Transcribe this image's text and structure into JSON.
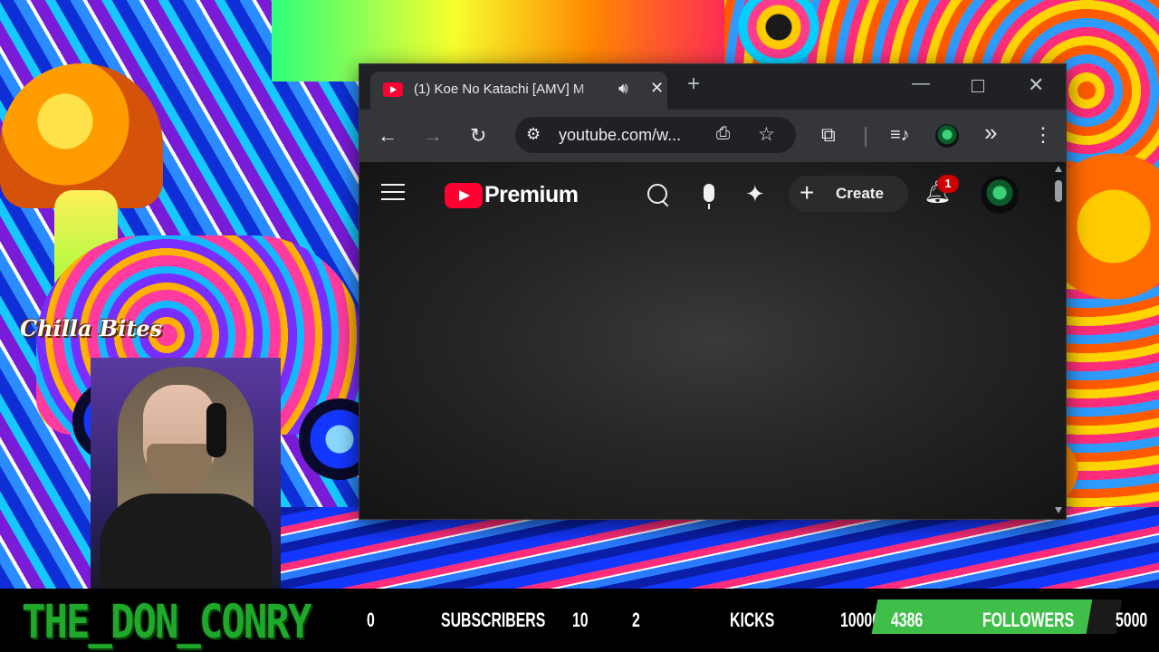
{
  "browser": {
    "tab": {
      "title": "(1) Koe No Katachi [AMV] M",
      "audio_icon": "speaker-icon",
      "close_glyph": "✕"
    },
    "new_tab_glyph": "+",
    "window_controls": {
      "minimize": "—",
      "close": "✕"
    },
    "toolbar": {
      "back": "←",
      "forward": "→",
      "reload": "↻",
      "url": "youtube.com/w...",
      "install_icon": "install-app-icon",
      "bookmark": "☆",
      "extensions_icon": "puzzle-icon",
      "media_icon": "media-controls-icon",
      "more_glyph": "»",
      "menu_glyph": "⋮"
    }
  },
  "youtube": {
    "brand": "Premium",
    "create_label": "Create",
    "notification_count": "1"
  },
  "overlay": {
    "logo_text": "Chilla Bites",
    "streamer_name": "THE_DON_CONRY",
    "stats": {
      "subscribers_count": "0",
      "subscribers_label": "SUBSCRIBERS",
      "subscribers_goal": "10",
      "kicks_count": "2",
      "kicks_label": "KICKS",
      "kicks_goal": "10000",
      "followers_count": "4386",
      "followers_label": "FOLLOWERS",
      "followers_goal": "5000",
      "followers_progress": 0.877
    }
  },
  "colors": {
    "youtube_red": "#ff0033",
    "name_green": "#1fa82a",
    "followers_green": "#3fbf4a",
    "notification_red": "#cc0000"
  }
}
